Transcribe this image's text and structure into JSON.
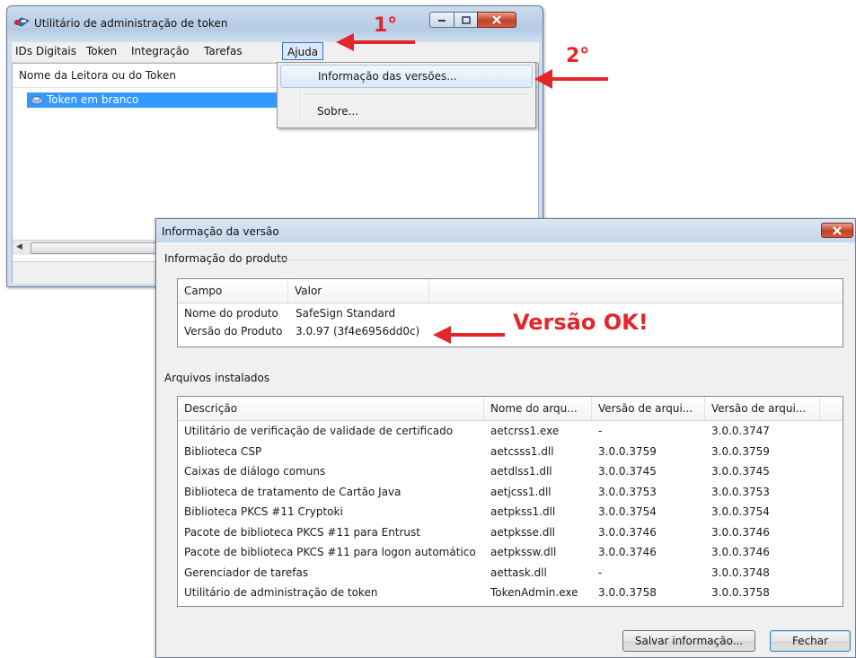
{
  "main_window": {
    "title": "Utilitário de administração de token",
    "menu": [
      "IDs Digitais",
      "Token",
      "Integração",
      "Tarefas",
      "Ajuda"
    ],
    "column_header": "Nome da Leitora ou do Token",
    "token_item": "Token em branco"
  },
  "dropdown": {
    "items": [
      "Informação das versões...",
      "Sobre..."
    ]
  },
  "dialog": {
    "title": "Informação da versão",
    "product_section": "Informação do produto",
    "product_columns": [
      "Campo",
      "Valor"
    ],
    "product_rows": [
      [
        "Nome do produto",
        "SafeSign Standard"
      ],
      [
        "Versão do Produto",
        "3.0.97 (3f4e6956dd0c)"
      ]
    ],
    "files_section": "Arquivos instalados",
    "files_columns": [
      "Descrição",
      "Nome do arqu...",
      "Versão de arqui...",
      "Versão de arqui..."
    ],
    "files_rows": [
      [
        "Utilitário de verificação de validade de certificado",
        "aetcrss1.exe",
        "-",
        "3.0.0.3747"
      ],
      [
        "Biblioteca CSP",
        "aetcsss1.dll",
        "3.0.0.3759",
        "3.0.0.3759"
      ],
      [
        "Caixas de diálogo comuns",
        "aetdlss1.dll",
        "3.0.0.3745",
        "3.0.0.3745"
      ],
      [
        "Biblioteca de tratamento de Cartão Java",
        "aetjcss1.dll",
        "3.0.0.3753",
        "3.0.0.3753"
      ],
      [
        "Biblioteca PKCS #11 Cryptoki",
        "aetpkss1.dll",
        "3.0.0.3754",
        "3.0.0.3754"
      ],
      [
        "Pacote de biblioteca PKCS #11 para Entrust",
        "aetpksse.dll",
        "3.0.0.3746",
        "3.0.0.3746"
      ],
      [
        "Pacote de biblioteca PKCS #11 para logon automático",
        "aetpkssw.dll",
        "3.0.0.3746",
        "3.0.0.3746"
      ],
      [
        "Gerenciador de tarefas",
        "aettask.dll",
        "-",
        "3.0.0.3748"
      ],
      [
        "Utilitário de administração de token",
        "TokenAdmin.exe",
        "3.0.0.3758",
        "3.0.0.3758"
      ]
    ],
    "save_button": "Salvar informação...",
    "close_button": "Fechar"
  },
  "annotations": {
    "step1": "1°",
    "step2": "2°",
    "version_ok": "Versão OK!",
    "color": "#e3262a"
  },
  "icons": [
    "token-app-icon",
    "minimize-icon",
    "maximize-icon",
    "close-icon",
    "token-icon",
    "arrow-icon"
  ]
}
